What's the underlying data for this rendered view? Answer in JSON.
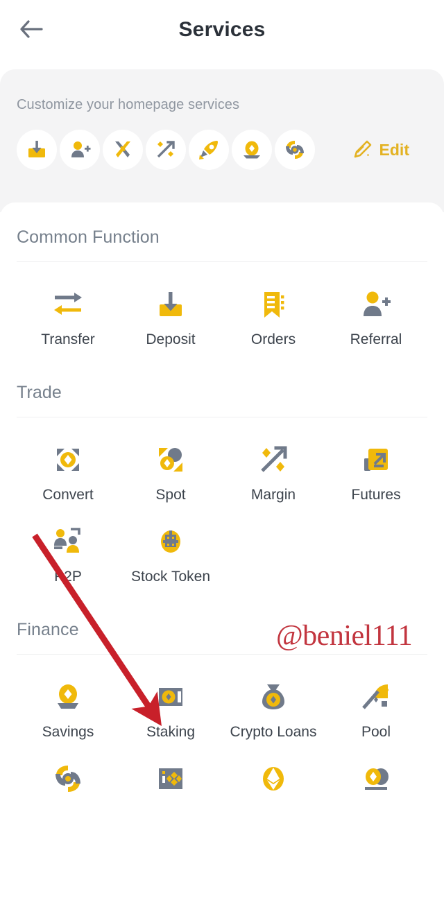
{
  "header": {
    "back_icon": "back-arrow-icon",
    "title": "Services"
  },
  "customize": {
    "caption": "Customize your homepage services",
    "edit_label": "Edit",
    "edit_icon": "pencil-edit-icon",
    "chips": [
      {
        "name": "deposit-chip-icon"
      },
      {
        "name": "referral-chip-icon"
      },
      {
        "name": "battle-swords-chip-icon"
      },
      {
        "name": "margin-percent-chip-icon"
      },
      {
        "name": "launchpad-rocket-chip-icon"
      },
      {
        "name": "savings-chip-icon"
      },
      {
        "name": "liquid-swap-chip-icon"
      }
    ]
  },
  "sections": [
    {
      "title": "Common Function",
      "items": [
        {
          "label": "Transfer",
          "icon": "transfer-icon"
        },
        {
          "label": "Deposit",
          "icon": "deposit-icon"
        },
        {
          "label": "Orders",
          "icon": "orders-icon"
        },
        {
          "label": "Referral",
          "icon": "referral-icon"
        }
      ]
    },
    {
      "title": "Trade",
      "items": [
        {
          "label": "Convert",
          "icon": "convert-icon"
        },
        {
          "label": "Spot",
          "icon": "spot-icon"
        },
        {
          "label": "Margin",
          "icon": "margin-icon"
        },
        {
          "label": "Futures",
          "icon": "futures-icon"
        },
        {
          "label": "P2P",
          "icon": "p2p-icon"
        },
        {
          "label": "Stock Token",
          "icon": "stock-token-icon"
        }
      ]
    },
    {
      "title": "Finance",
      "items": [
        {
          "label": "Savings",
          "icon": "savings-icon"
        },
        {
          "label": "Staking",
          "icon": "staking-icon"
        },
        {
          "label": "Crypto Loans",
          "icon": "crypto-loans-icon"
        },
        {
          "label": "Pool",
          "icon": "pool-icon"
        },
        {
          "label": "",
          "icon": "liquid-swap-icon"
        },
        {
          "label": "",
          "icon": "bnb-vault-icon"
        },
        {
          "label": "",
          "icon": "eth-staking-icon"
        },
        {
          "label": "",
          "icon": "dual-investment-icon"
        }
      ]
    }
  ],
  "watermark": {
    "text": "@beniel111"
  },
  "annotation": {
    "arrow_color": "#c8202a",
    "points_to": "Staking"
  },
  "colors": {
    "brand_yellow": "#f0b90b",
    "icon_gray": "#707a8a",
    "text_dark": "#2b3139",
    "text_muted": "#76808c",
    "panel_bg": "#f4f4f5",
    "annotation_red": "#c8202a",
    "watermark_red": "#c2353f"
  }
}
